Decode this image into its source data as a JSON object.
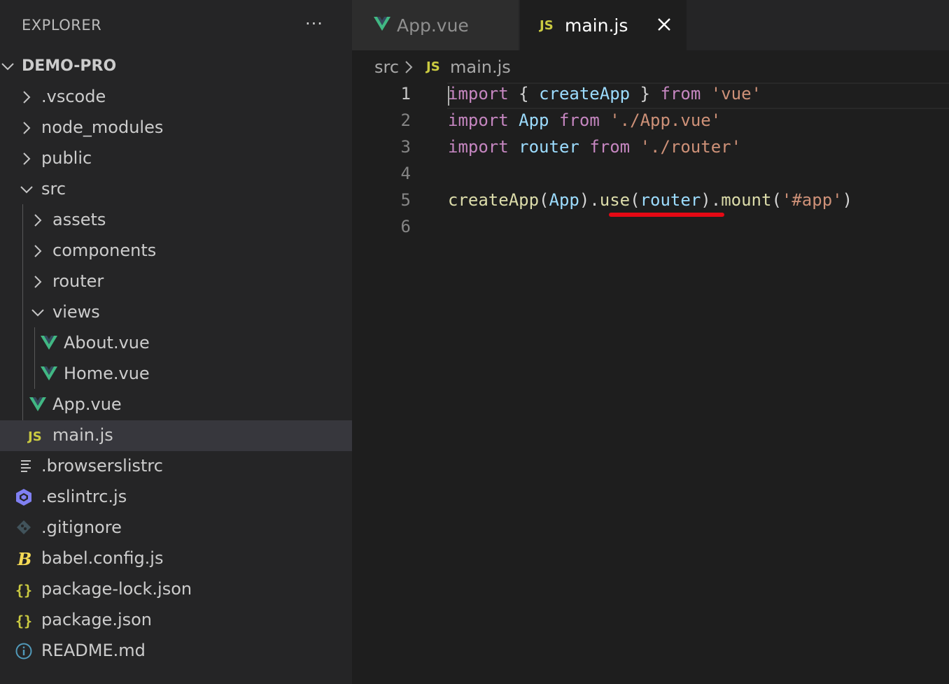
{
  "explorer": {
    "title": "EXPLORER",
    "more": "···",
    "root": "DEMO-PRO",
    "items": [
      {
        "label": ".vscode"
      },
      {
        "label": "node_modules"
      },
      {
        "label": "public"
      },
      {
        "label": "src"
      },
      {
        "label": "assets"
      },
      {
        "label": "components"
      },
      {
        "label": "router"
      },
      {
        "label": "views"
      },
      {
        "label": "About.vue"
      },
      {
        "label": "Home.vue"
      },
      {
        "label": "App.vue"
      },
      {
        "label": "main.js"
      },
      {
        "label": ".browserslistrc"
      },
      {
        "label": ".eslintrc.js"
      },
      {
        "label": ".gitignore"
      },
      {
        "label": "babel.config.js"
      },
      {
        "label": "package-lock.json"
      },
      {
        "label": "package.json"
      },
      {
        "label": "README.md"
      }
    ]
  },
  "tabs": [
    {
      "label": "App.vue",
      "icon": "vue-icon"
    },
    {
      "label": "main.js",
      "icon": "js-icon",
      "badge": "JS"
    }
  ],
  "breadcrumb": {
    "folder": "src",
    "js_badge": "JS",
    "file": "main.js"
  },
  "editor": {
    "line_numbers": [
      "1",
      "2",
      "3",
      "4",
      "5",
      "6"
    ],
    "lines": {
      "l1": {
        "t1": "import",
        "t2": " { ",
        "t3": "createApp",
        "t4": " } ",
        "t5": "from",
        "t6": " ",
        "t7": "'vue'"
      },
      "l2": {
        "t1": "import",
        "t2": " ",
        "t3": "App",
        "t4": " ",
        "t5": "from",
        "t6": " ",
        "t7": "'./App.vue'"
      },
      "l3": {
        "t1": "import",
        "t2": " ",
        "t3": "router",
        "t4": " ",
        "t5": "from",
        "t6": " ",
        "t7": "'./router'"
      },
      "l5": {
        "t1": "createApp",
        "t2": "(",
        "t3": "App",
        "t4": ").",
        "t5": "use",
        "t6": "(",
        "t7": "router",
        "t8": ").",
        "t9": "mount",
        "t10": "(",
        "t11": "'#app'",
        "t12": ")"
      }
    }
  },
  "colors": {
    "keyword": "#c586c0",
    "identifier": "#9cdcfe",
    "function": "#dcdcaa",
    "string": "#ce9178",
    "vue_green": "#41b883",
    "js_yellow": "#cbcb41",
    "annotation_red": "#e50914"
  }
}
